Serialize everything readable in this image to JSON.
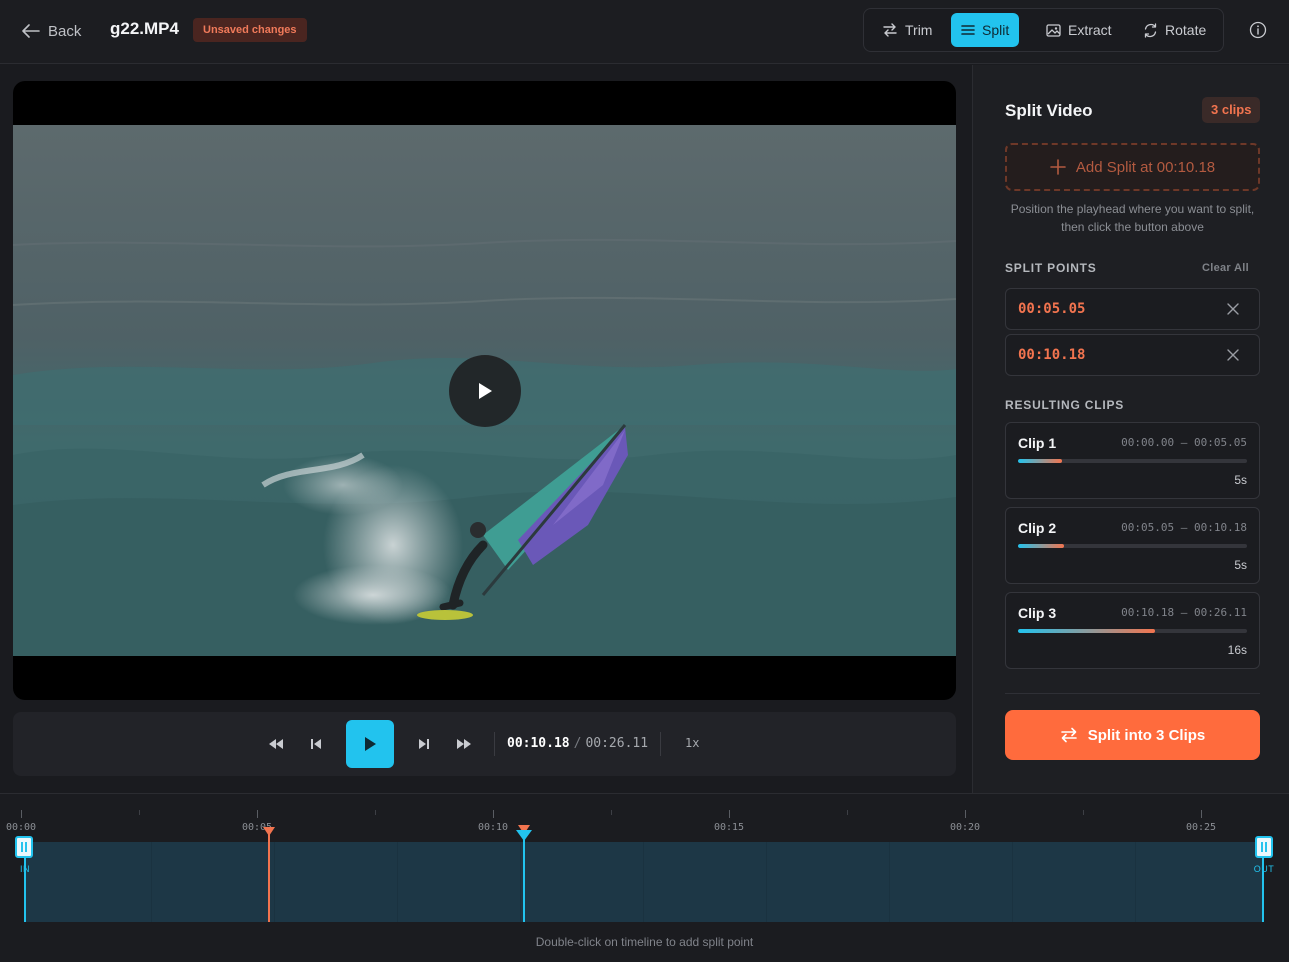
{
  "header": {
    "back_label": "Back",
    "file_name": "g22.MP4",
    "unsaved_label": "Unsaved changes",
    "tools": [
      {
        "label": "Trim",
        "icon": "swap-arrows-icon",
        "active": false
      },
      {
        "label": "Split",
        "icon": "lines-icon",
        "active": true
      },
      {
        "label": "Extract",
        "icon": "image-icon",
        "active": false
      },
      {
        "label": "Rotate",
        "icon": "rotate-icon",
        "active": false
      }
    ],
    "info_icon": "info-icon"
  },
  "player": {
    "current_time": "00:10.18",
    "separator": "/",
    "total_time": "00:26.11",
    "speed": "1x",
    "playing": false
  },
  "panel": {
    "title": "Split Video",
    "clips_badge": "3 clips",
    "add_split_label": "Add Split at 00:10.18",
    "hint": "Position the playhead where you want to split, then click the button above",
    "split_points_label": "SPLIT POINTS",
    "clear_all_label": "Clear All",
    "split_points": [
      "00:05.05",
      "00:10.18"
    ],
    "resulting_clips_label": "RESULTING CLIPS",
    "clips": [
      {
        "name": "Clip 1",
        "range": "00:00.00 – 00:05.05",
        "duration": "5s",
        "share": 0.19
      },
      {
        "name": "Clip 2",
        "range": "00:05.05 – 00:10.18",
        "duration": "5s",
        "share": 0.2
      },
      {
        "name": "Clip 3",
        "range": "00:10.18 – 00:26.11",
        "duration": "16s",
        "share": 0.6
      }
    ],
    "cta_label": "Split into 3 Clips"
  },
  "timeline": {
    "tick_labels": [
      "00:00",
      "00:05",
      "00:10",
      "00:15",
      "00:20",
      "00:25"
    ],
    "in_label": "IN",
    "out_label": "OUT",
    "hint": "Double-click on timeline to add split point"
  },
  "colors": {
    "accent": "#22c3ee",
    "split": "#f2744f",
    "cta": "#ff6b3d"
  }
}
